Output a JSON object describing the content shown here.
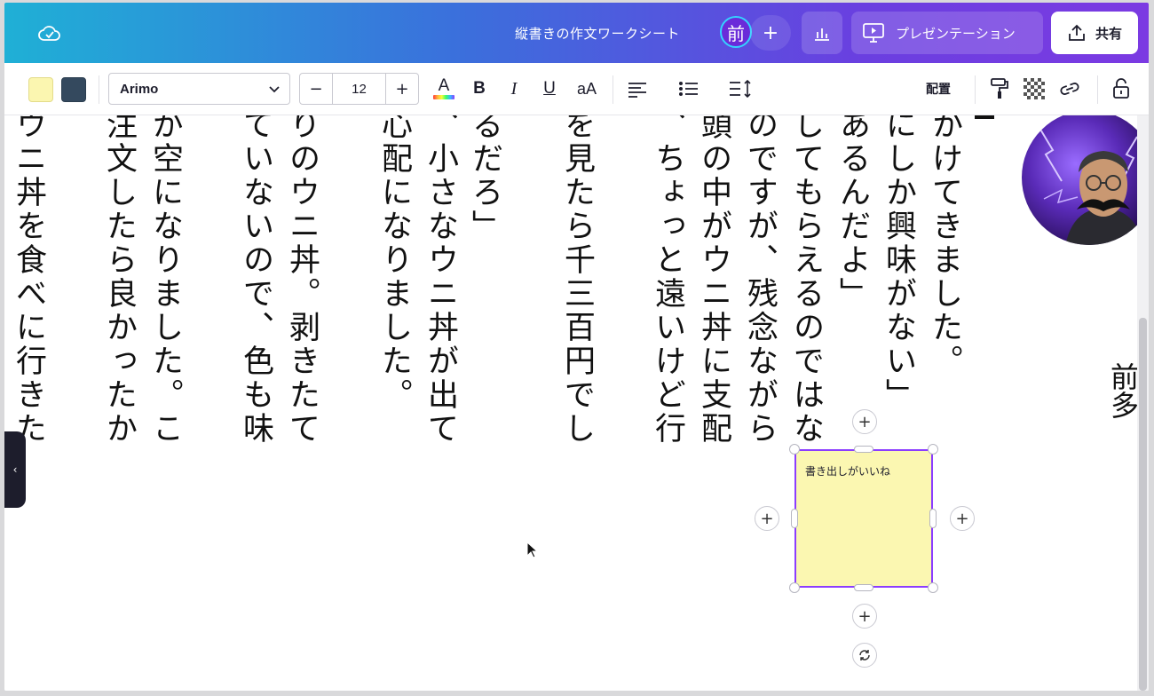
{
  "header": {
    "doc_title": "縦書きの作文ワークシート",
    "avatar_initial": "前",
    "invite_label": "+",
    "present_label": "プレゼンテーション",
    "share_label": "共有"
  },
  "toolbar": {
    "colors": [
      "#fbf6b0",
      "#34495e"
    ],
    "font_name": "Arimo",
    "font_size": "12",
    "decrease_label": "−",
    "increase_label": "+",
    "text_color_label": "A",
    "bold_label": "B",
    "italic_label": "I",
    "underline_label": "U",
    "case_label": "aA",
    "arrange_label": "配置"
  },
  "canvas": {
    "columns": [
      "かけてきました。",
      "にしか興味がない」",
      "あるんだよ」",
      "してもらえるのではな",
      "のですが、残念ながら",
      "頭の中がウニ丼に支配",
      "、ちょっと遠いけど行",
      "を見たら千三百円でし",
      "、小さなウニ丼が出て",
      "るだろ」",
      "心配になりました。",
      "りのウニ丼。剥きたて",
      "ていないので、色も味",
      "が空になりました。こ",
      "注文したら良かったか",
      "ウニ丼を食べに行きた"
    ],
    "right_edge_text": "前多",
    "sticky_note_text": "書き出しがいいね"
  }
}
